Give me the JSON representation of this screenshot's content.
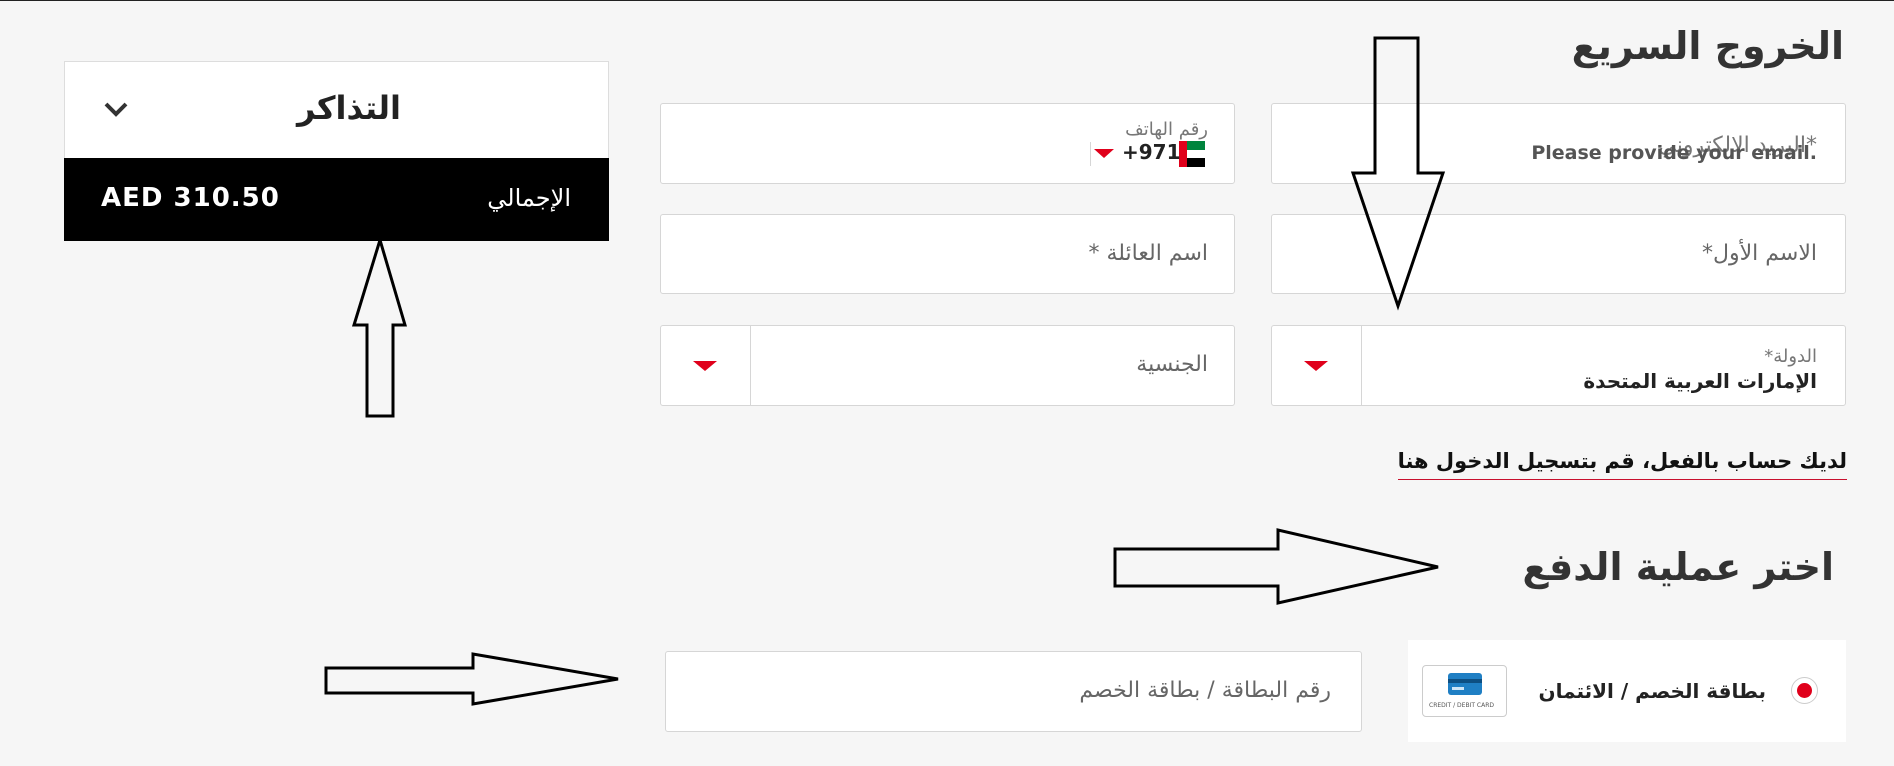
{
  "checkout": {
    "title": "الخروج السريع",
    "email_placeholder": "*البريد الالكتروني",
    "email_error": "Please provide your email.",
    "phone_label": "رقم الهاتف",
    "phone_code": "+971",
    "first_name_placeholder": "الاسم الأول*",
    "last_name_placeholder": "اسم العائلة *",
    "country_label": "الدولة*",
    "country_value": "الإمارات العربية المتحدة",
    "nationality_placeholder": "الجنسية",
    "login_link": "لديك حساب بالفعل، قم بتسجيل الدخول هنا"
  },
  "summary": {
    "title": "التذاكر",
    "total_label": "الإجمالي",
    "total_value": "AED 310.50"
  },
  "payment": {
    "title": "اختر عملية الدفع",
    "option_label": "بطاقة الخصم / الائتمان",
    "card_badge_text": "CREDIT / DEBIT CARD",
    "card_number_placeholder": "رقم البطاقة / بطاقة الخصم"
  },
  "colors": {
    "accent": "#e0001b",
    "summary_bar": "#000000",
    "background": "#f6f6f6",
    "card_icon": "#1f7fc4"
  },
  "icons": {
    "chevron": "chevron-down-icon",
    "dropdown": "dropdown-caret-icon",
    "flag": "uae-flag-icon",
    "card": "credit-card-icon",
    "radio": "radio-selected-icon"
  }
}
